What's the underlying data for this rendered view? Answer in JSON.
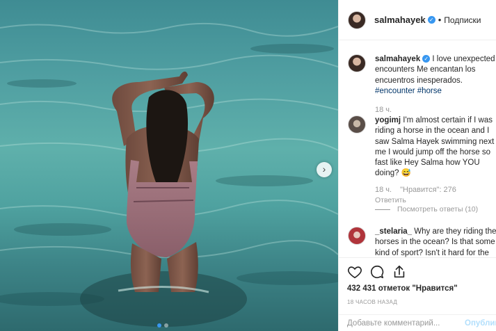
{
  "post": {
    "username": "salmahayek",
    "separator": "•",
    "follow_label": "Подписки",
    "caption": "I love unexpected encounters Me encantan los encuentros inesperados.",
    "caption_tag_1": "#encounter",
    "caption_tag_2": "#horse",
    "caption_time": "18 ч."
  },
  "comments": [
    {
      "user": "yogimj",
      "text": "I'm almost certain if I was riding a horse in the ocean and I saw Salma Hayek swimming next to me I would jump off the horse so fast like Hey Salma how YOU doing? 😅",
      "time": "18 ч.",
      "likes": "\"Нравится\": 276",
      "reply": "Ответить",
      "view_replies": "Посмотреть ответы (10)"
    },
    {
      "user": "_stelaria_",
      "text": "Why are they riding the horses in the ocean? Is that some kind of sport? Isn't it hard for the"
    }
  ],
  "stats": {
    "likes": "432 431 отметок \"Нравится\"",
    "time": "18 ЧАСОВ НАЗАД"
  },
  "composer": {
    "placeholder": "Добавьте комментарий...",
    "post_label": "Опубликовать"
  },
  "icons": [
    "heart-icon",
    "comment-icon",
    "share-icon",
    "chevron-right-icon",
    "verified-icon"
  ],
  "colors": {
    "link": "#003569",
    "verified": "#3897f0",
    "muted": "#999999",
    "post_disabled": "#b2dffc"
  }
}
